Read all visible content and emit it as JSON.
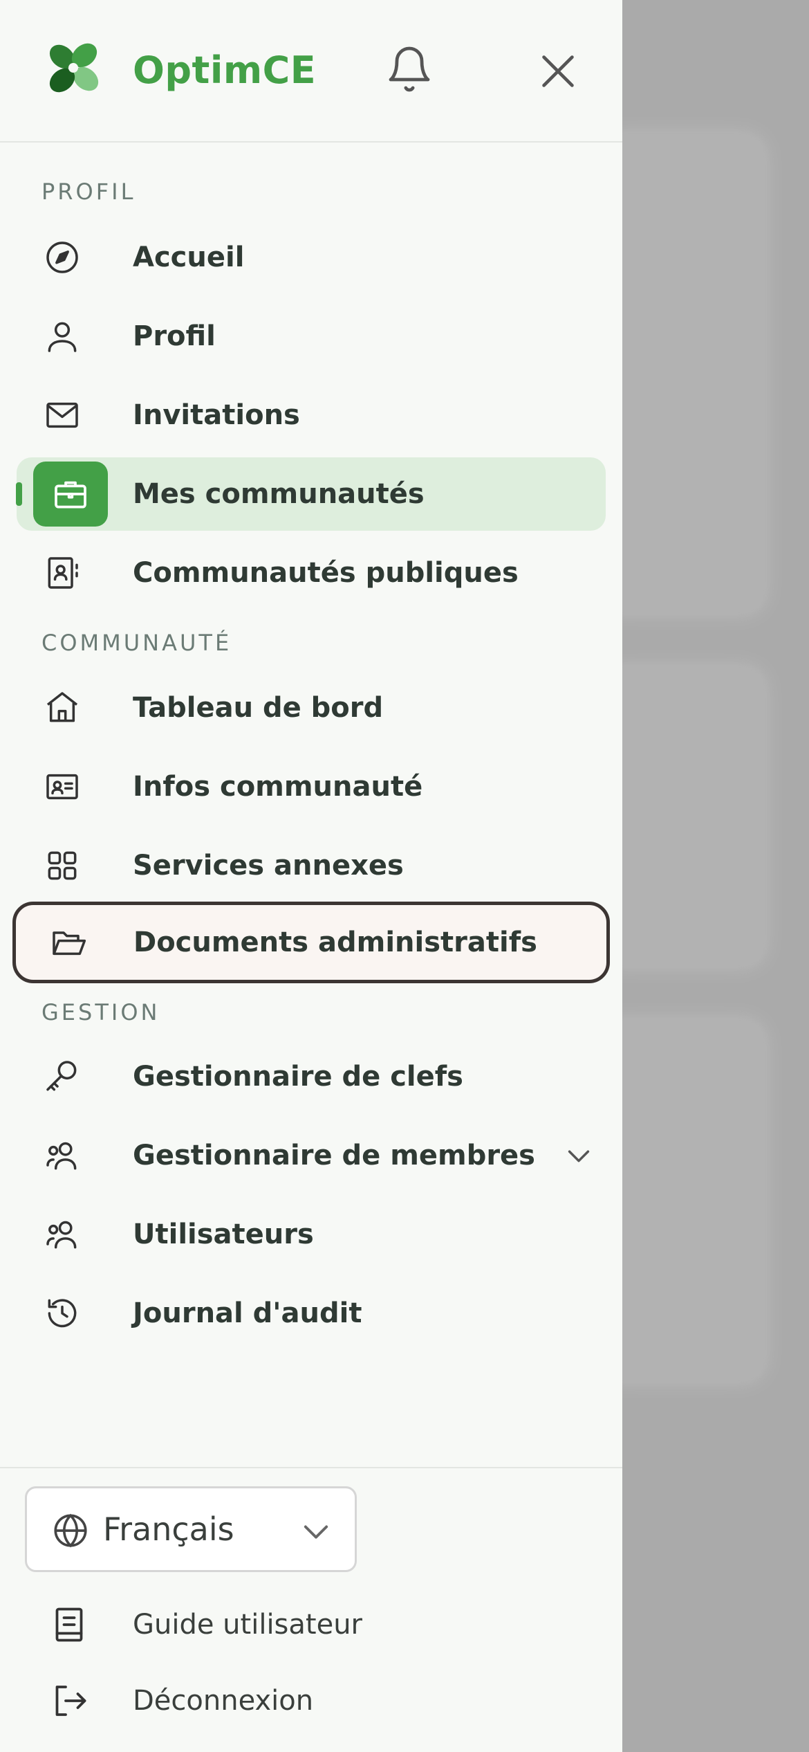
{
  "app": {
    "name": "OptimCE",
    "brand_color": "#43a047"
  },
  "header": {
    "logo_icon": "clover-logo-icon",
    "notification_icon": "bell-icon",
    "close_icon": "close-icon"
  },
  "sections": {
    "profil": "PROFIL",
    "communaute": "COMMUNAUTÉ",
    "gestion": "GESTION"
  },
  "nav": {
    "accueil": "Accueil",
    "profil": "Profil",
    "invitations": "Invitations",
    "mes_communautes": "Mes communautés",
    "communautes_publiques": "Communautés publiques",
    "tableau_de_bord": "Tableau de bord",
    "infos_communaute": "Infos communauté",
    "services_annexes": "Services annexes",
    "documents_administratifs": "Documents administratifs",
    "gestionnaire_clefs": "Gestionnaire de clefs",
    "gestionnaire_membres": "Gestionnaire de membres",
    "utilisateurs": "Utilisateurs",
    "journal_audit": "Journal d'audit"
  },
  "language": {
    "selected": "Français"
  },
  "footer": {
    "guide": "Guide utilisateur",
    "logout": "Déconnexion"
  }
}
